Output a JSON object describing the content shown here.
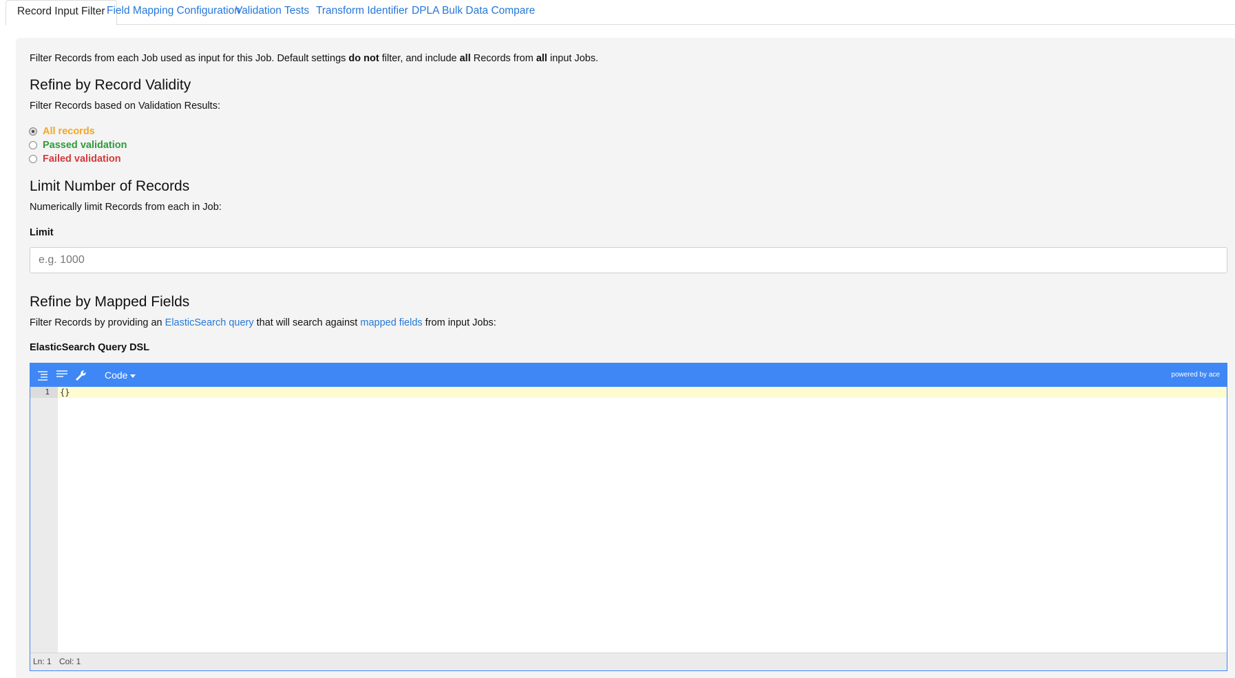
{
  "tabs": [
    {
      "label": "Record Input Filter",
      "active": true
    },
    {
      "label": "Field Mapping Configuration",
      "active": false
    },
    {
      "label": "Validation Tests",
      "active": false
    },
    {
      "label": "Transform Identifier",
      "active": false
    },
    {
      "label": "DPLA Bulk Data Compare",
      "active": false
    }
  ],
  "intro": {
    "part1": "Filter Records from each Job used as input for this Job. Default settings ",
    "bold1": "do not",
    "part2": " filter, and include ",
    "bold2": "all",
    "part3": " Records from ",
    "bold3": "all",
    "part4": " input Jobs."
  },
  "validity": {
    "title": "Refine by Record Validity",
    "subtitle": "Filter Records based on Validation Results:",
    "options": [
      {
        "label": "All records",
        "color": "#f5a623",
        "checked": true
      },
      {
        "label": "Passed validation",
        "color": "#2f9a3a",
        "checked": false
      },
      {
        "label": "Failed validation",
        "color": "#d33a3a",
        "checked": false
      }
    ]
  },
  "limit": {
    "title": "Limit Number of Records",
    "subtitle": "Numerically limit Records from each in Job:",
    "field_label": "Limit",
    "value": "",
    "placeholder": "e.g. 1000"
  },
  "mapped": {
    "title": "Refine by Mapped Fields",
    "sub_part1": "Filter Records by providing an ",
    "link1": "ElasticSearch query",
    "sub_part2": " that will search against ",
    "link2": "mapped fields",
    "sub_part3": " from input Jobs:",
    "field_label": "ElasticSearch Query DSL"
  },
  "editor": {
    "toolbar": {
      "icons": [
        "format-icon",
        "compact-icon",
        "repair-icon"
      ],
      "mode_label": "Code",
      "powered_by": "powered by ace"
    },
    "line_number": "1",
    "code": "{}",
    "status": {
      "ln": "Ln: 1",
      "col": "Col: 1"
    },
    "accent_color": "#3f87f5"
  }
}
